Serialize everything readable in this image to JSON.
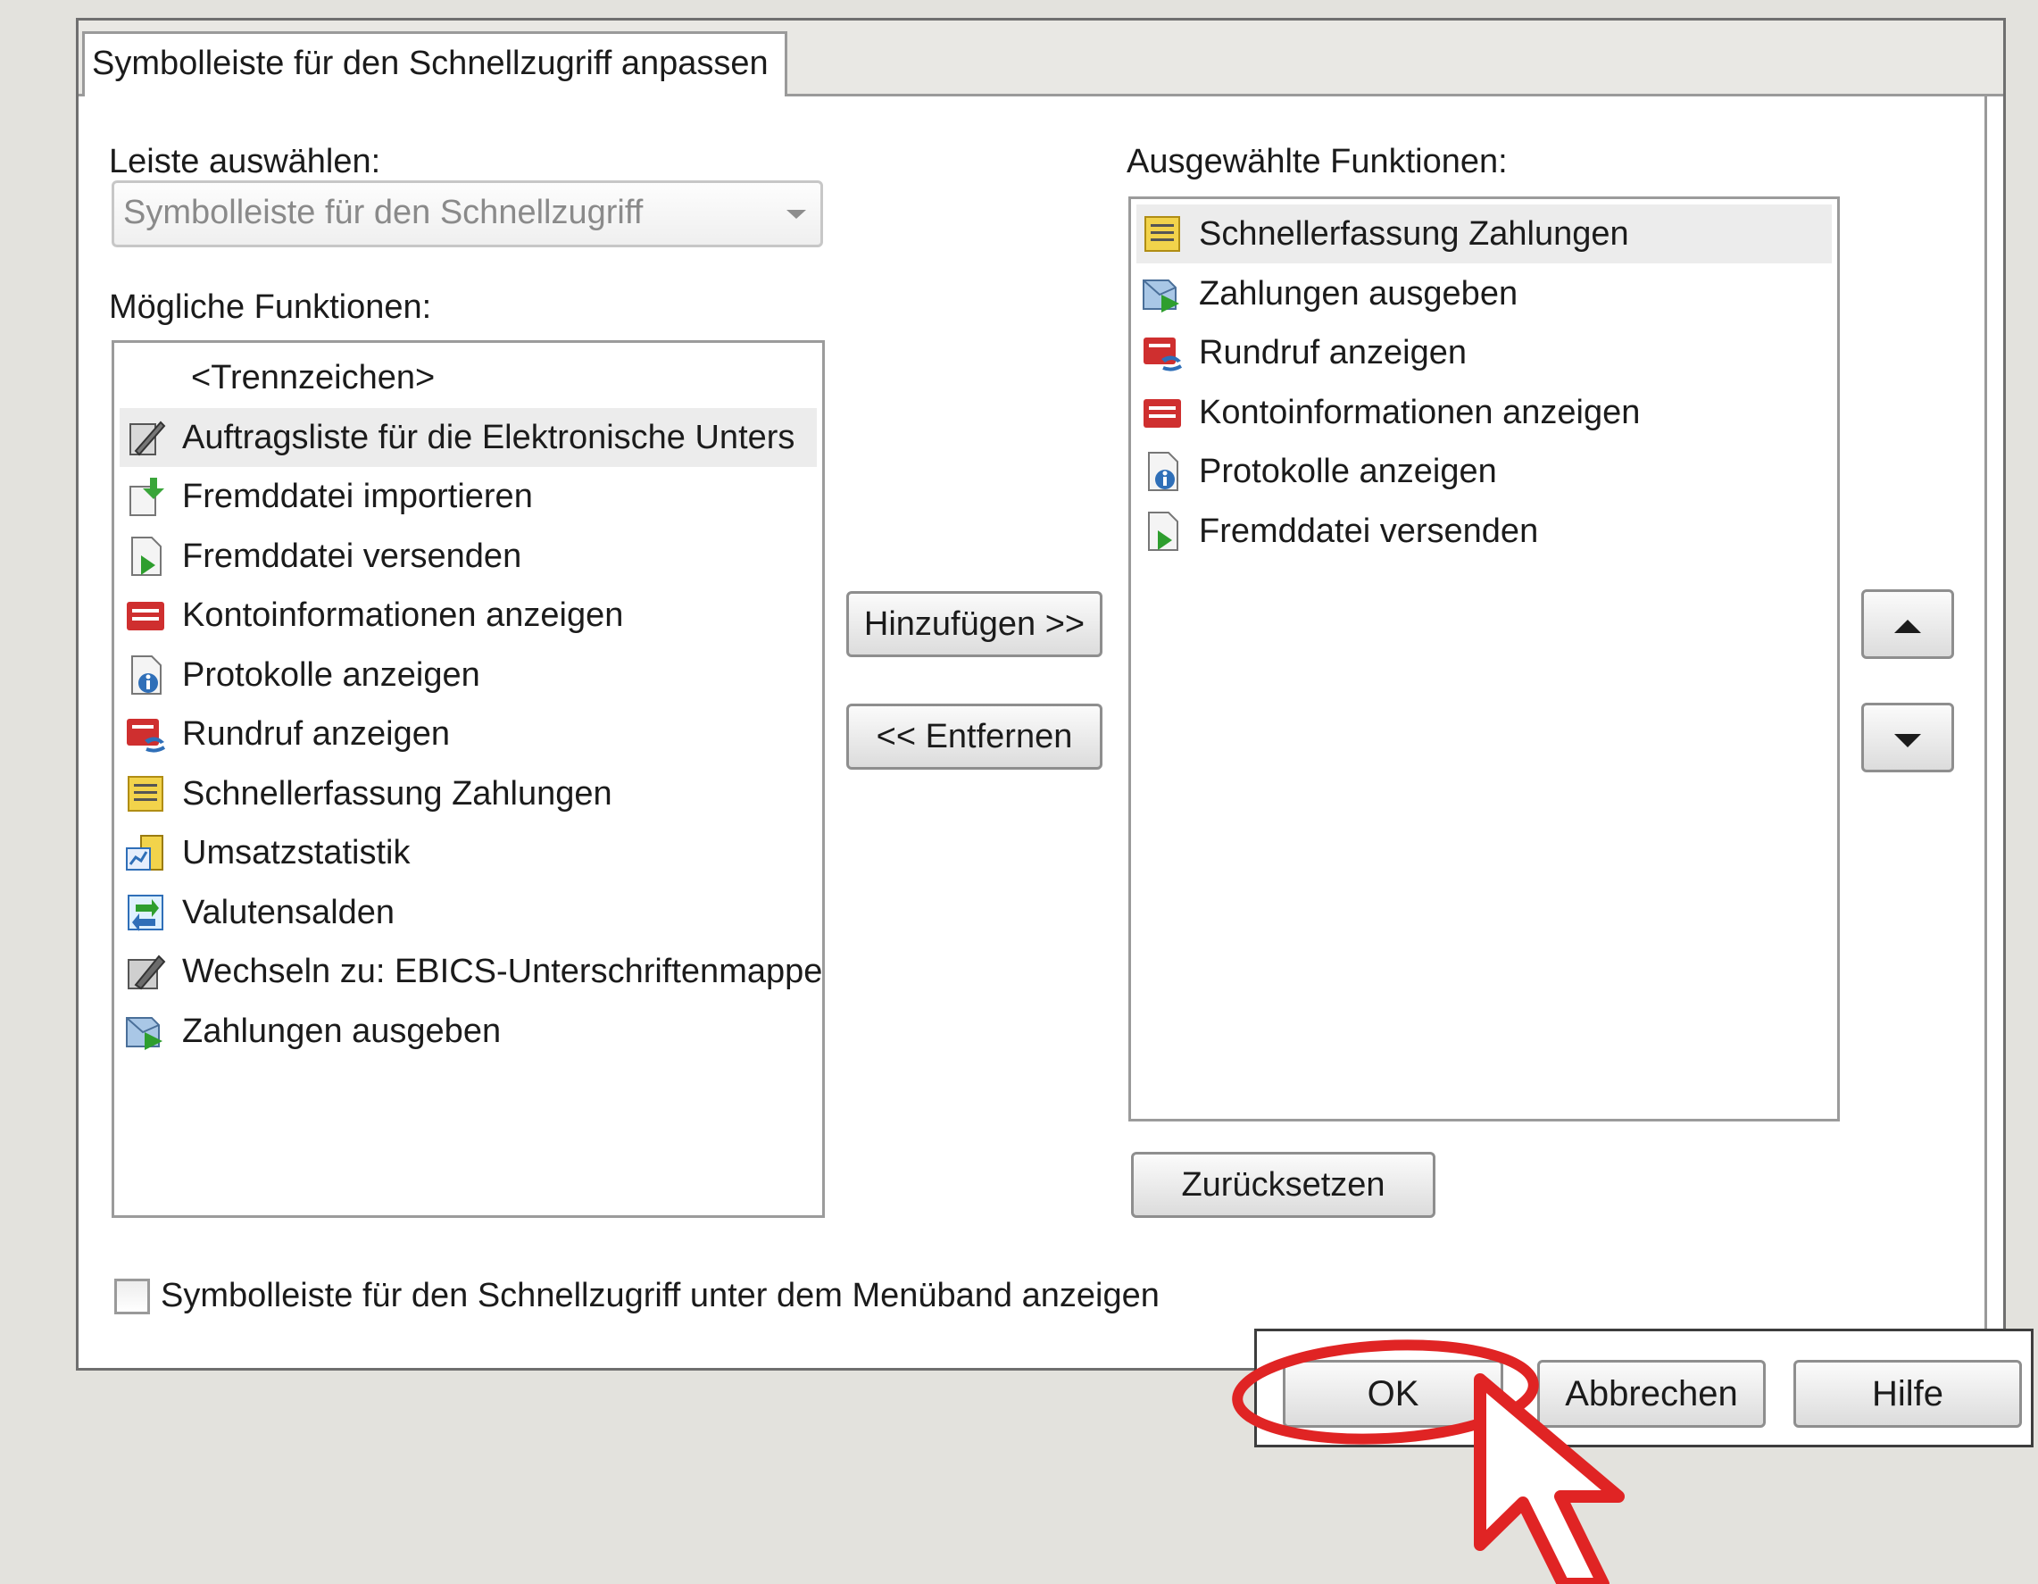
{
  "dialog": {
    "tab_title": "Symbolleiste für den Schnellzugriff anpassen",
    "select_bar_label": "Leiste auswählen:",
    "select_bar_value": "Symbolleiste für den Schnellzugriff",
    "available_label": "Mögliche Funktionen:",
    "selected_label": "Ausgewählte Funktionen:",
    "available_items": [
      {
        "label": "<Trennzeichen>",
        "icon": "none"
      },
      {
        "label": "Auftragsliste für die Elektronische Unters",
        "icon": "pen-document-icon"
      },
      {
        "label": "Fremddatei importieren",
        "icon": "import-file-icon"
      },
      {
        "label": "Fremddatei versenden",
        "icon": "send-file-icon"
      },
      {
        "label": "Kontoinformationen anzeigen",
        "icon": "account-info-icon"
      },
      {
        "label": "Protokolle anzeigen",
        "icon": "protocol-info-icon"
      },
      {
        "label": "Rundruf anzeigen",
        "icon": "broadcast-icon"
      },
      {
        "label": "Schnellerfassung Zahlungen",
        "icon": "quick-entry-icon"
      },
      {
        "label": "Umsatzstatistik",
        "icon": "statistics-icon"
      },
      {
        "label": "Valutensalden",
        "icon": "value-balances-icon"
      },
      {
        "label": "Wechseln zu: EBICS-Unterschriftenmappe",
        "icon": "signature-folder-icon"
      },
      {
        "label": "Zahlungen ausgeben",
        "icon": "output-payments-icon"
      }
    ],
    "selected_items": [
      {
        "label": "Schnellerfassung Zahlungen",
        "icon": "quick-entry-icon"
      },
      {
        "label": "Zahlungen ausgeben",
        "icon": "output-payments-icon"
      },
      {
        "label": "Rundruf anzeigen",
        "icon": "broadcast-icon"
      },
      {
        "label": "Kontoinformationen anzeigen",
        "icon": "account-info-icon"
      },
      {
        "label": "Protokolle anzeigen",
        "icon": "protocol-info-icon"
      },
      {
        "label": "Fremddatei versenden",
        "icon": "send-file-icon"
      }
    ],
    "add_button": "Hinzufügen >>",
    "remove_button": "<< Entfernen",
    "reset_button": "Zurücksetzen",
    "checkbox_label": "Symbolleiste für den Schnellzugriff unter dem Menüband anzeigen",
    "checkbox_checked": false,
    "ok_button": "OK",
    "cancel_button": "Abbrechen",
    "help_button": "Hilfe"
  },
  "colors": {
    "highlight_circle": "#e02424",
    "cursor_outline": "#e02424",
    "selection_bg": "#ececec"
  }
}
